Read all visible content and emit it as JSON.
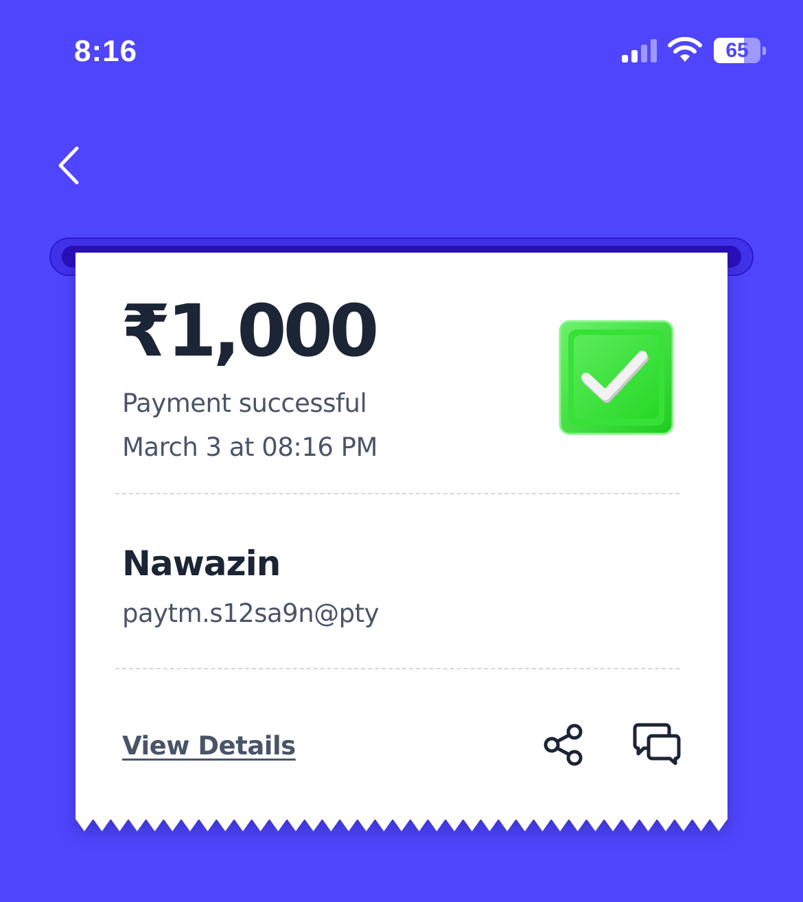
{
  "status_bar": {
    "time": "8:16",
    "battery_percent": 65,
    "battery_label": "65",
    "signal_icon": "cellular-signal-icon",
    "wifi_icon": "wifi-icon"
  },
  "nav": {
    "back_icon": "chevron-left-icon"
  },
  "receipt": {
    "amount": "₹1,000",
    "status": "Payment successful",
    "datetime": "March 3 at 08:16 PM",
    "status_icon": "green-checkmark-icon",
    "payee_name": "Nawazin",
    "payee_vpa": "paytm.s12sa9n@pty",
    "view_details_label": "View Details",
    "share_icon": "share-icon",
    "chat_icon": "chat-bubbles-icon"
  },
  "colors": {
    "background": "#4F45FD",
    "receipt": "#FFFFFF",
    "text_dark": "#1C2535",
    "text_muted": "#4A5468",
    "success_green": "#2FE02F"
  }
}
